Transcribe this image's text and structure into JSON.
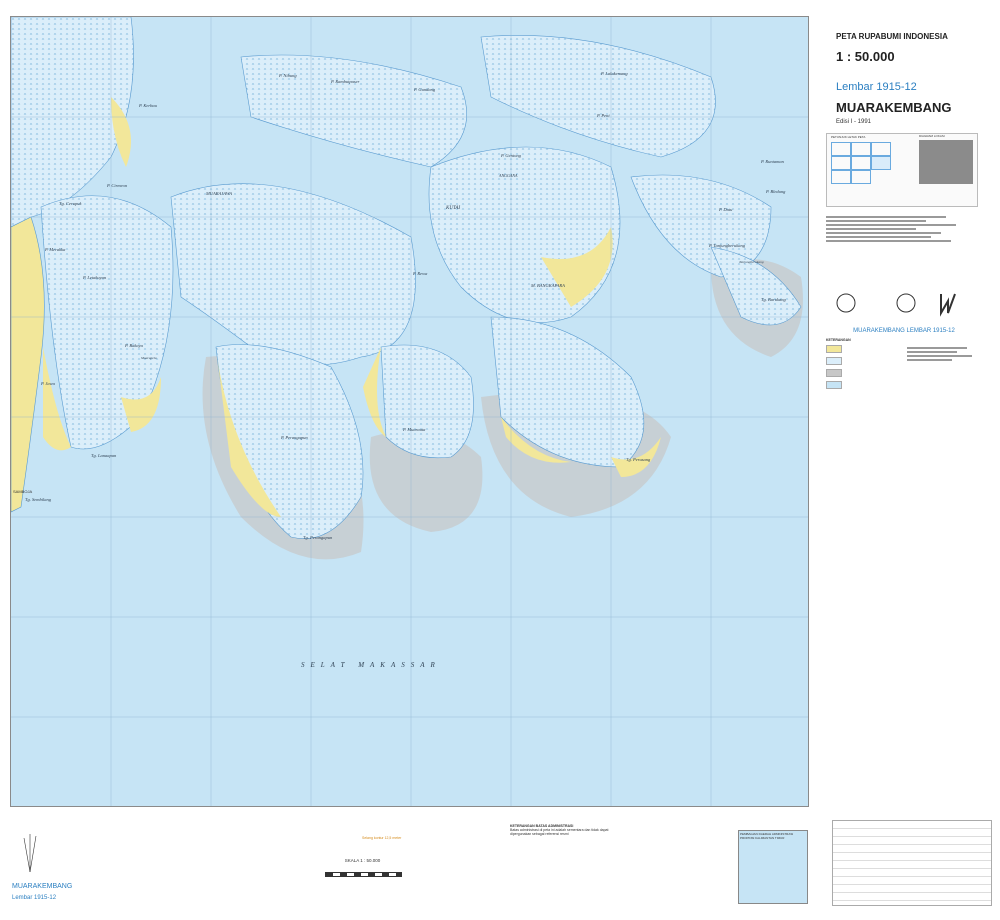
{
  "header": {
    "series": "PETA RUPABUMI INDONESIA",
    "scale": "1 : 50.000",
    "sheet_number": "Lembar 1915-12",
    "sheet_name": "MUARAKEMBANG",
    "edition": "Edisi I - 1991"
  },
  "map": {
    "sea_name": "SELAT MAKASSAR",
    "places": [
      "P. Nibung",
      "P. Rambutpaser",
      "P. Gundang",
      "P. Lalakemang",
      "P. Peni",
      "P. Kerbau",
      "P. Cirmeon",
      "MUARAJAWA",
      "KUTAI",
      "P. Gentong",
      "ANGGANA",
      "P. Runtaman",
      "P. Bledung",
      "P. Datu",
      "P. Tanjungberukang",
      "Tanjungberukang",
      "P. Rewa",
      "M. BANGKAPARA",
      "P. Laxiambuk",
      "Tg. Cerupuk",
      "P. Merakka",
      "P. Letakuyan",
      "P. Bakaya",
      "Muarapelu",
      "P. Jawa",
      "Tg. Lanaapan",
      "Tg. Sembilang",
      "SAMBOJA",
      "P. Perangapun",
      "P. Muarauta",
      "Tg. Perangapun",
      "Tg. Perusang",
      "Tg. Barukang",
      "MUARA PEMANGKARANG",
      "M. BORA"
    ]
  },
  "legend": {
    "index_title": "PETUNJUK LETAK PETA",
    "relief_title": "DIAGRAM LOKASI",
    "sheet_banner": "MUARAKEMBANG  LEMBAR 1915-12",
    "keys_title": "KETERANGAN"
  },
  "footer": {
    "sheet_name": "MUARAKEMBANG",
    "sheet_number": "Lembar 1915-12",
    "scale_label": "SKALA 1 : 50.000",
    "contour_note": "Selang kontur 12,5 meter",
    "admin_title": "KETERANGAN BATAS ADMINISTRASI",
    "admin_text": "Batas administrasi di peta ini adalah sementara dan tidak dapat dipergunakan sebagai referensi resmi",
    "inset_title": "PEMBAGIAN DAERAH ADMINISTRASI PROPINSI KALIMANTAN TIMUR"
  },
  "colors": {
    "sea": "#c6e4f5",
    "land": "#d7ecf8",
    "sand": "#f2e79a",
    "shoal": "#c9c9c9",
    "accent": "#2b7fc1"
  }
}
